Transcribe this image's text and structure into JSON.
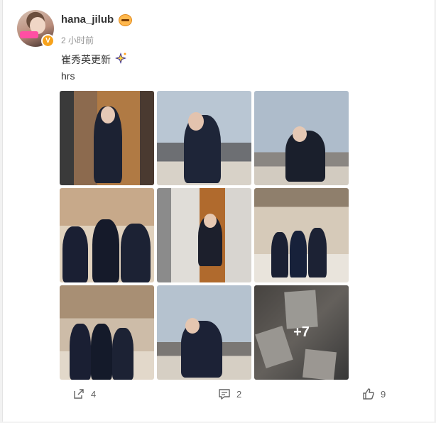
{
  "post": {
    "username": "hana_jilub",
    "timestamp": "2 小时前",
    "text_line_1": "崔秀英更新",
    "text_line_2": "hrs",
    "badge_icon": "emoji-badge-icon",
    "sparkle_icon": "sparkle-icon",
    "verified_icon": "verified-v-icon",
    "verified_symbol": "V"
  },
  "images": [
    {
      "name": "photo-1",
      "description_icon": "photo"
    },
    {
      "name": "photo-2",
      "description_icon": "photo"
    },
    {
      "name": "photo-3",
      "description_icon": "photo"
    },
    {
      "name": "photo-4",
      "description_icon": "photo"
    },
    {
      "name": "photo-5",
      "description_icon": "photo"
    },
    {
      "name": "photo-6",
      "description_icon": "photo"
    },
    {
      "name": "photo-7",
      "description_icon": "photo"
    },
    {
      "name": "photo-8",
      "description_icon": "photo"
    },
    {
      "name": "photo-9",
      "description_icon": "photo"
    }
  ],
  "more_count_label": "+7",
  "actions": {
    "share_count": "4",
    "comment_count": "2",
    "like_count": "9"
  },
  "colors": {
    "text": "#333333",
    "muted": "#939393",
    "action": "#636363",
    "verified": "#f7a21b"
  }
}
